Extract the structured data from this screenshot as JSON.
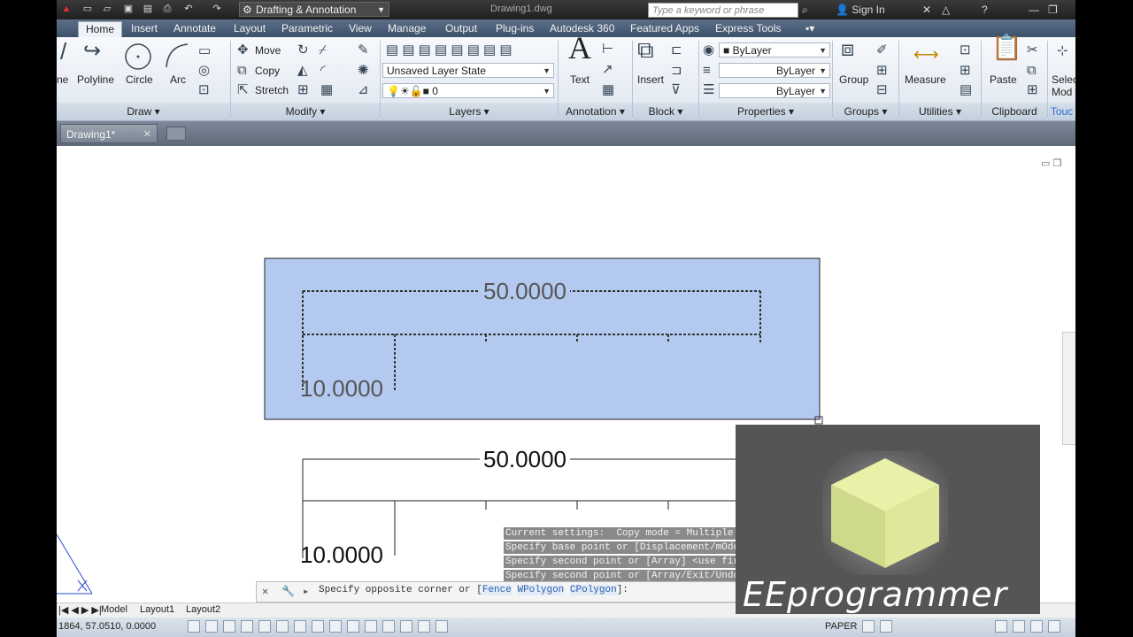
{
  "titlebar": {
    "workspace": "Drafting & Annotation",
    "doc_title": "Drawing1.dwg",
    "search_placeholder": "Type a keyword or phrase",
    "signin_label": "Sign In"
  },
  "ribbon_tabs": [
    "Home",
    "Insert",
    "Annotate",
    "Layout",
    "Parametric",
    "View",
    "Manage",
    "Output",
    "Plug-ins",
    "Autodesk 360",
    "Featured Apps",
    "Express Tools"
  ],
  "ribbon": {
    "draw": {
      "items": [
        "ne",
        "Polyline",
        "Circle",
        "Arc"
      ],
      "title": "Draw"
    },
    "modify": {
      "items": [
        "Move",
        "Copy",
        "Stretch"
      ],
      "title": "Modify"
    },
    "layers": {
      "layer_state": "Unsaved Layer State",
      "layer_current": "0",
      "title": "Layers"
    },
    "annotation": {
      "text_label": "Text",
      "title": "Annotation"
    },
    "block": {
      "insert_label": "Insert",
      "title": "Block"
    },
    "properties": {
      "color": "ByLayer",
      "linetype": "ByLayer",
      "lineweight": "ByLayer",
      "title": "Properties"
    },
    "groups": {
      "group_label": "Group",
      "title": "Groups"
    },
    "utilities": {
      "measure_label": "Measure",
      "title": "Utilities"
    },
    "clipboard": {
      "paste_label": "Paste",
      "title": "Clipboard"
    },
    "extra": {
      "select_label": "Selec",
      "mode_label": "Mod",
      "touch_label": "Touc"
    }
  },
  "file_tab": {
    "name": "Drawing1*"
  },
  "drawing": {
    "dim_top_1": "50.0000",
    "dim_bottom_1": "10.0000",
    "dim_top_2": "50.0000",
    "dim_bottom_2": "10.0000"
  },
  "command_history": [
    "Current settings:  Copy mode = Multiple",
    "Specify base point or [Displacement/mOde] <Displacement>:",
    "Specify second point or [Array] <use first point as displacement>:",
    "Specify second point or [Array/Exit/Undo] <Exit>: *Cancel*"
  ],
  "command_line": {
    "prompt": "Specify opposite corner or [",
    "opt1": "Fence",
    "opt2": "WPolygon",
    "opt3": "CPolygon",
    "end": "]:"
  },
  "layout_tabs": [
    "Model",
    "Layout1",
    "Layout2"
  ],
  "status": {
    "coords": "1864, 57.0510, 0.0000",
    "paper": "PAPER"
  },
  "watermark": {
    "text": "EEprogrammer"
  },
  "colors": {
    "selection_fill": "#b3c9ef",
    "ribbon_tab_bg": "#4a5d77"
  }
}
